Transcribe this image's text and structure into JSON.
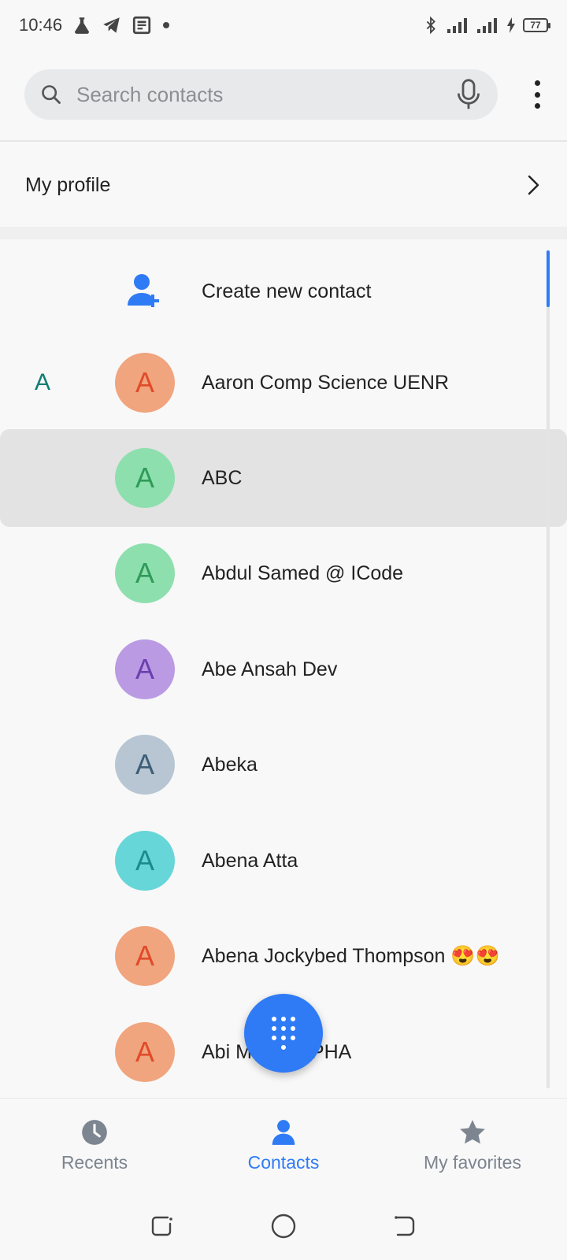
{
  "status_bar": {
    "time": "10:46",
    "battery": "77",
    "icons": [
      "flask-icon",
      "telegram-icon",
      "news-icon",
      "dot-icon",
      "bluetooth-icon",
      "signal-icon",
      "signal-icon-2",
      "charging-icon"
    ]
  },
  "search": {
    "placeholder": "Search contacts"
  },
  "profile": {
    "label": "My profile"
  },
  "create_contact": {
    "label": "Create new contact"
  },
  "section_letter": "A",
  "contacts": [
    {
      "initial": "A",
      "name": "Aaron Comp Science UENR",
      "bg": "#f0a57e",
      "fg": "#e04b2a"
    },
    {
      "initial": "A",
      "name": "ABC",
      "bg": "#8edfae",
      "fg": "#2e9b58"
    },
    {
      "initial": "A",
      "name": "Abdul Samed @ ICode",
      "bg": "#8edfae",
      "fg": "#2e9b58"
    },
    {
      "initial": "A",
      "name": "Abe Ansah Dev",
      "bg": "#bb9ae4",
      "fg": "#6a3fae"
    },
    {
      "initial": "A",
      "name": "Abeka",
      "bg": "#b7c6d2",
      "fg": "#3d5e78"
    },
    {
      "initial": "A",
      "name": "Abena Atta",
      "bg": "#67d6d9",
      "fg": "#1a8c8f"
    },
    {
      "initial": "A",
      "name": "Abena Jockybed Thompson 😍😍",
      "bg": "#f0a57e",
      "fg": "#e04b2a"
    },
    {
      "initial": "A",
      "name": "Abi MoMo GPHA",
      "bg": "#f0a57e",
      "fg": "#e04b2a"
    }
  ],
  "bottom_nav": {
    "recents": "Recents",
    "contacts": "Contacts",
    "favorites": "My favorites"
  },
  "colors": {
    "accent": "#2f7bf5",
    "section_letter": "#107d72"
  }
}
